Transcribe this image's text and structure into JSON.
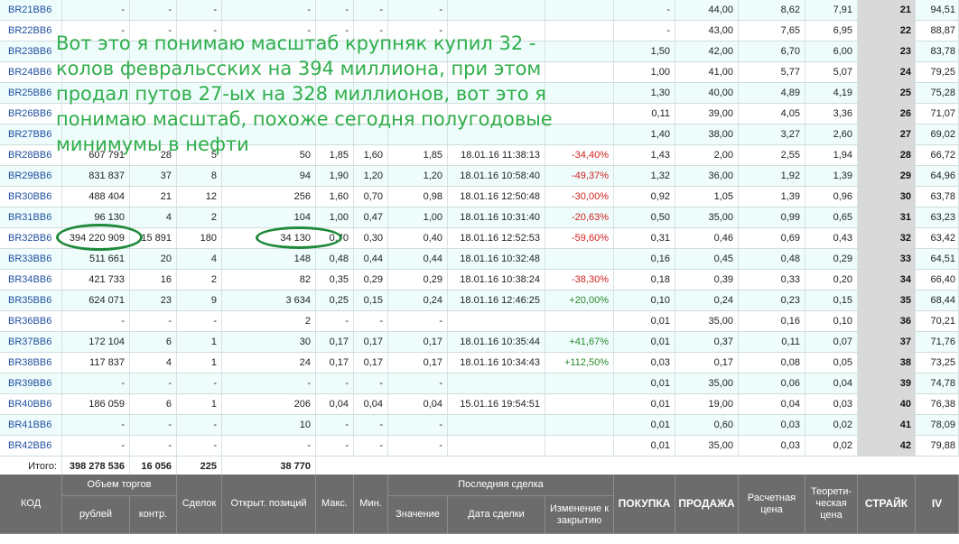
{
  "annotation_text": "Вот это я понимаю масштаб крупняк купил 32 - колов февральсских на 394 миллиона, при этом продал путов 27-ых на 328 миллионов, вот это я понимаю масштаб, похоже сегодня полугодовые минимумы в нефти",
  "columns": {
    "code": "КОД",
    "volume_group": "Объем торгов",
    "rubles": "рублей",
    "contracts": "контр.",
    "deals": "Сделок",
    "open_interest": "Открыт. позиций",
    "max": "Макс.",
    "min": "Мин.",
    "last_deal_group": "Последняя сделка",
    "value": "Значение",
    "deal_date": "Дата сделки",
    "change": "Изменение к закрытию",
    "bid": "ПОКУПКА",
    "ask": "ПРОДАЖА",
    "settle": "Расчетная цена",
    "theoretical": "Теорети- ческая цена",
    "strike": "СТРАЙК",
    "iv": "IV"
  },
  "rows": [
    {
      "code": "BR21BB6",
      "rub": "-",
      "contr": "-",
      "deals": "-",
      "oi": "-",
      "max": "-",
      "min": "-",
      "val": "-",
      "date": "",
      "chg": "",
      "bid": "-",
      "ask": "44,00",
      "settle": "8,62",
      "theo": "7,91",
      "strike": "21",
      "iv": "94,51"
    },
    {
      "code": "BR22BB6",
      "rub": "-",
      "contr": "-",
      "deals": "-",
      "oi": "-",
      "max": "-",
      "min": "-",
      "val": "-",
      "date": "",
      "chg": "",
      "bid": "-",
      "ask": "43,00",
      "settle": "7,65",
      "theo": "6,95",
      "strike": "22",
      "iv": "88,87"
    },
    {
      "code": "BR23BB6",
      "rub": "",
      "contr": "",
      "deals": "",
      "oi": "",
      "max": "",
      "min": "",
      "val": "",
      "date": "",
      "chg": "",
      "bid": "1,50",
      "ask": "42,00",
      "settle": "6,70",
      "theo": "6,00",
      "strike": "23",
      "iv": "83,78"
    },
    {
      "code": "BR24BB6",
      "rub": "",
      "contr": "",
      "deals": "",
      "oi": "",
      "max": "",
      "min": "",
      "val": "",
      "date": "",
      "chg": "",
      "bid": "1,00",
      "ask": "41,00",
      "settle": "5,77",
      "theo": "5,07",
      "strike": "24",
      "iv": "79,25"
    },
    {
      "code": "BR25BB6",
      "rub": "",
      "contr": "",
      "deals": "",
      "oi": "",
      "max": "",
      "min": "",
      "val": "",
      "date": "",
      "chg": "",
      "bid": "1,30",
      "ask": "40,00",
      "settle": "4,89",
      "theo": "4,19",
      "strike": "25",
      "iv": "75,28"
    },
    {
      "code": "BR26BB6",
      "rub": "",
      "contr": "",
      "deals": "",
      "oi": "",
      "max": "",
      "min": "",
      "val": "",
      "date": "",
      "chg": "",
      "bid": "0,11",
      "ask": "39,00",
      "settle": "4,05",
      "theo": "3,36",
      "strike": "26",
      "iv": "71,07"
    },
    {
      "code": "BR27BB6",
      "rub": "",
      "contr": "",
      "deals": "",
      "oi": "",
      "max": "",
      "min": "",
      "val": "",
      "date": "",
      "chg": "",
      "bid": "1,40",
      "ask": "38,00",
      "settle": "3,27",
      "theo": "2,60",
      "strike": "27",
      "iv": "69,02"
    },
    {
      "code": "BR28BB6",
      "rub": "607 791",
      "contr": "28",
      "deals": "5",
      "oi": "50",
      "max": "1,85",
      "min": "1,60",
      "val": "1,85",
      "date": "18.01.16 11:38:13",
      "chg": "-34,40%",
      "bid": "1,43",
      "ask": "2,00",
      "settle": "2,55",
      "theo": "1,94",
      "strike": "28",
      "iv": "66,72"
    },
    {
      "code": "BR29BB6",
      "rub": "831 837",
      "contr": "37",
      "deals": "8",
      "oi": "94",
      "max": "1,90",
      "min": "1,20",
      "val": "1,20",
      "date": "18.01.16 10:58:40",
      "chg": "-49,37%",
      "bid": "1,32",
      "ask": "36,00",
      "settle": "1,92",
      "theo": "1,39",
      "strike": "29",
      "iv": "64,96"
    },
    {
      "code": "BR30BB6",
      "rub": "488 404",
      "contr": "21",
      "deals": "12",
      "oi": "256",
      "max": "1,60",
      "min": "0,70",
      "val": "0,98",
      "date": "18.01.16 12:50:48",
      "chg": "-30,00%",
      "bid": "0,92",
      "ask": "1,05",
      "settle": "1,39",
      "theo": "0,96",
      "strike": "30",
      "iv": "63,78"
    },
    {
      "code": "BR31BB6",
      "rub": "96 130",
      "contr": "4",
      "deals": "2",
      "oi": "104",
      "max": "1,00",
      "min": "0,47",
      "val": "1,00",
      "date": "18.01.16 10:31:40",
      "chg": "-20,63%",
      "bid": "0,50",
      "ask": "35,00",
      "settle": "0,99",
      "theo": "0,65",
      "strike": "31",
      "iv": "63,23"
    },
    {
      "code": "BR32BB6",
      "rub": "394 220 909",
      "contr": "15 891",
      "deals": "180",
      "oi": "34 130",
      "max": "0,70",
      "min": "0,30",
      "val": "0,40",
      "date": "18.01.16 12:52:53",
      "chg": "-59,60%",
      "bid": "0,31",
      "ask": "0,46",
      "settle": "0,69",
      "theo": "0,43",
      "strike": "32",
      "iv": "63,42"
    },
    {
      "code": "BR33BB6",
      "rub": "511 661",
      "contr": "20",
      "deals": "4",
      "oi": "148",
      "max": "0,48",
      "min": "0,44",
      "val": "0,44",
      "date": "18.01.16 10:32:48",
      "chg": "",
      "bid": "0,16",
      "ask": "0,45",
      "settle": "0,48",
      "theo": "0,29",
      "strike": "33",
      "iv": "64,51"
    },
    {
      "code": "BR34BB6",
      "rub": "421 733",
      "contr": "16",
      "deals": "2",
      "oi": "82",
      "max": "0,35",
      "min": "0,29",
      "val": "0,29",
      "date": "18.01.16 10:38:24",
      "chg": "-38,30%",
      "bid": "0,18",
      "ask": "0,39",
      "settle": "0,33",
      "theo": "0,20",
      "strike": "34",
      "iv": "66,40"
    },
    {
      "code": "BR35BB6",
      "rub": "624 071",
      "contr": "23",
      "deals": "9",
      "oi": "3 634",
      "max": "0,25",
      "min": "0,15",
      "val": "0,24",
      "date": "18.01.16 12:46:25",
      "chg": "+20,00%",
      "bid": "0,10",
      "ask": "0,24",
      "settle": "0,23",
      "theo": "0,15",
      "strike": "35",
      "iv": "68,44"
    },
    {
      "code": "BR36BB6",
      "rub": "-",
      "contr": "-",
      "deals": "-",
      "oi": "2",
      "max": "-",
      "min": "-",
      "val": "-",
      "date": "",
      "chg": "",
      "bid": "0,01",
      "ask": "35,00",
      "settle": "0,16",
      "theo": "0,10",
      "strike": "36",
      "iv": "70,21"
    },
    {
      "code": "BR37BB6",
      "rub": "172 104",
      "contr": "6",
      "deals": "1",
      "oi": "30",
      "max": "0,17",
      "min": "0,17",
      "val": "0,17",
      "date": "18.01.16 10:35:44",
      "chg": "+41,67%",
      "bid": "0,01",
      "ask": "0,37",
      "settle": "0,11",
      "theo": "0,07",
      "strike": "37",
      "iv": "71,76"
    },
    {
      "code": "BR38BB6",
      "rub": "117 837",
      "contr": "4",
      "deals": "1",
      "oi": "24",
      "max": "0,17",
      "min": "0,17",
      "val": "0,17",
      "date": "18.01.16 10:34:43",
      "chg": "+112,50%",
      "bid": "0,03",
      "ask": "0,17",
      "settle": "0,08",
      "theo": "0,05",
      "strike": "38",
      "iv": "73,25"
    },
    {
      "code": "BR39BB6",
      "rub": "-",
      "contr": "-",
      "deals": "-",
      "oi": "-",
      "max": "-",
      "min": "-",
      "val": "-",
      "date": "",
      "chg": "",
      "bid": "0,01",
      "ask": "35,00",
      "settle": "0,06",
      "theo": "0,04",
      "strike": "39",
      "iv": "74,78"
    },
    {
      "code": "BR40BB6",
      "rub": "186 059",
      "contr": "6",
      "deals": "1",
      "oi": "206",
      "max": "0,04",
      "min": "0,04",
      "val": "0,04",
      "date": "15.01.16 19:54:51",
      "chg": "",
      "bid": "0,01",
      "ask": "19,00",
      "settle": "0,04",
      "theo": "0,03",
      "strike": "40",
      "iv": "76,38"
    },
    {
      "code": "BR41BB6",
      "rub": "-",
      "contr": "-",
      "deals": "-",
      "oi": "10",
      "max": "-",
      "min": "-",
      "val": "-",
      "date": "",
      "chg": "",
      "bid": "0,01",
      "ask": "0,60",
      "settle": "0,03",
      "theo": "0,02",
      "strike": "41",
      "iv": "78,09"
    },
    {
      "code": "BR42BB6",
      "rub": "-",
      "contr": "-",
      "deals": "-",
      "oi": "-",
      "max": "-",
      "min": "-",
      "val": "-",
      "date": "",
      "chg": "",
      "bid": "0,01",
      "ask": "35,00",
      "settle": "0,03",
      "theo": "0,02",
      "strike": "42",
      "iv": "79,88"
    }
  ],
  "totals": {
    "label": "Итого:",
    "rub": "398 278 536",
    "contr": "16 056",
    "deals": "225",
    "oi": "38 770"
  }
}
